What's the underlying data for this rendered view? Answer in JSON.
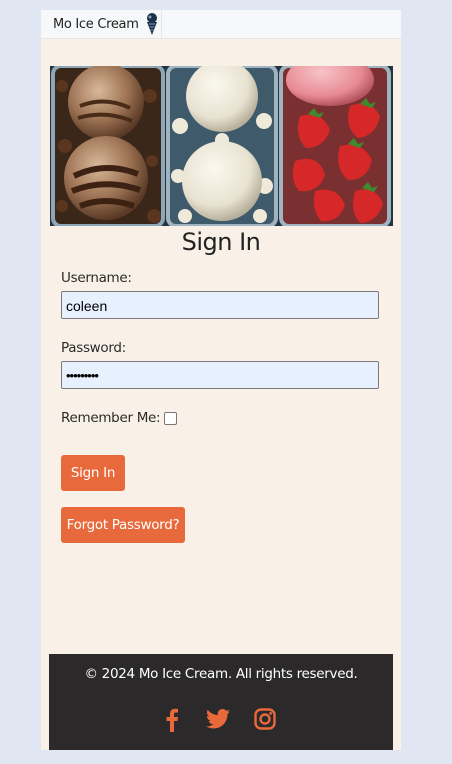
{
  "navbar": {
    "brand": "Mo Ice Cream",
    "brand_icon": "ice-cream-cone-icon"
  },
  "hero": {
    "flavors": [
      "chocolate",
      "vanilla",
      "strawberry"
    ]
  },
  "form": {
    "title": "Sign In",
    "username_label": "Username:",
    "username_value": "coleen",
    "password_label": "Password:",
    "password_value": "•••••••••",
    "remember_label": "Remember Me:",
    "remember_checked": false,
    "submit_label": "Sign In",
    "forgot_label": "Forgot Password?"
  },
  "footer": {
    "copyright": "© 2024 Mo Ice Cream. All rights reserved.",
    "social_icons": [
      "facebook-icon",
      "twitter-icon",
      "instagram-icon"
    ]
  },
  "colors": {
    "page_bg": "#e1e6f3",
    "card_bg": "#f9f1e7",
    "accent": "#e86a3c",
    "footer_bg": "#2b2929",
    "input_bg": "#e7f0fe"
  }
}
